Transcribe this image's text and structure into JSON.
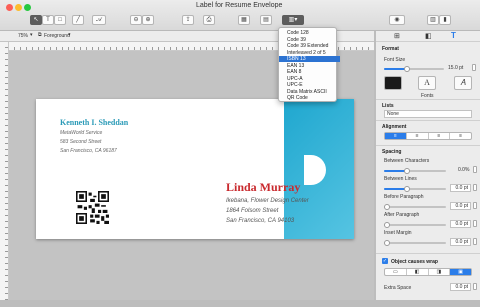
{
  "window": {
    "title": "Label for Resume Envelope"
  },
  "toolbar": {
    "font_size_display": "75%",
    "layer": "Foreground"
  },
  "barcode_menu": {
    "items": [
      "Code 128",
      "Code 39",
      "Code 39 Extended",
      "Interleaved 2 of 5",
      "ISBN 13",
      "EAN 13",
      "EAN 8",
      "UPC-A",
      "UPC-E",
      "Data Matrix ASCII",
      "QR Code"
    ],
    "selected": "ISBN 13"
  },
  "envelope": {
    "sender": {
      "name": "Kenneth I. Sheddan",
      "lines": [
        "MetaWorld Service",
        "583 Second Street",
        "San Francisco, CA 96187"
      ]
    },
    "recipient": {
      "name": "Linda Murray",
      "lines": [
        "Ikebana, Flower Design Center",
        "1864 Folsom Street",
        "San Francisco, CA 94103"
      ]
    },
    "accent_color": "#2a9ab7",
    "recipient_color": "#c9292d"
  },
  "inspector": {
    "format_heading": "Format",
    "font_size_label": "Font Size",
    "font_size_value": "15.0 pt",
    "fonts_label": "Fonts",
    "lists_heading": "Lists",
    "lists_value": "None",
    "alignment_heading": "Alignment",
    "spacing_heading": "Spacing",
    "between_characters_label": "Between Characters",
    "between_characters_value": "0.0%",
    "between_lines_label": "Between Lines",
    "between_lines_value": "0.0 pt",
    "before_paragraph_label": "Before Paragraph",
    "before_paragraph_value": "0.0 pt",
    "after_paragraph_label": "After Paragraph",
    "after_paragraph_value": "0.0 pt",
    "inset_margin_label": "Inset Margin",
    "inset_margin_value": "0.0 pt",
    "object_wrap_label": "Object causes wrap",
    "extra_space_label": "Extra Space",
    "extra_space_value": "0.0 pt"
  }
}
